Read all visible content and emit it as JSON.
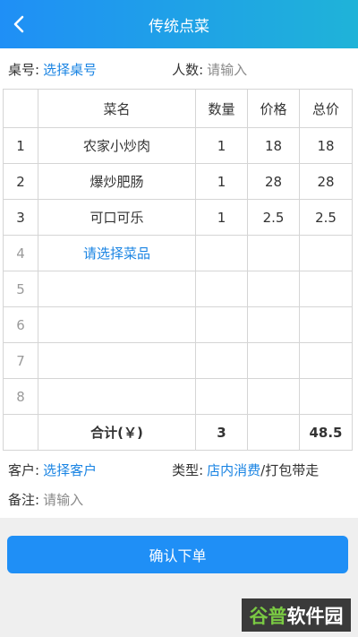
{
  "header": {
    "title": "传统点菜"
  },
  "info": {
    "table_label": "桌号:",
    "table_link": "选择桌号",
    "people_label": "人数:",
    "people_placeholder": "请输入"
  },
  "grid": {
    "headers": [
      "",
      "菜名",
      "数量",
      "价格",
      "总价"
    ],
    "rows": [
      {
        "idx": "1",
        "name": "农家小炒肉",
        "qty": "1",
        "price": "18",
        "total": "18"
      },
      {
        "idx": "2",
        "name": "爆炒肥肠",
        "qty": "1",
        "price": "28",
        "total": "28"
      },
      {
        "idx": "3",
        "name": "可口可乐",
        "qty": "1",
        "price": "2.5",
        "total": "2.5"
      },
      {
        "idx": "4",
        "name": "请选择菜品",
        "qty": "",
        "price": "",
        "total": ""
      },
      {
        "idx": "5",
        "name": "",
        "qty": "",
        "price": "",
        "total": ""
      },
      {
        "idx": "6",
        "name": "",
        "qty": "",
        "price": "",
        "total": ""
      },
      {
        "idx": "7",
        "name": "",
        "qty": "",
        "price": "",
        "total": ""
      },
      {
        "idx": "8",
        "name": "",
        "qty": "",
        "price": "",
        "total": ""
      }
    ],
    "footer": {
      "label": "合计(￥)",
      "qty": "3",
      "total": "48.5"
    }
  },
  "customer": {
    "label": "客户:",
    "link": "选择客户",
    "type_label": "类型:",
    "type_dine_in": "店内消费",
    "type_takeout": "/打包带走"
  },
  "note": {
    "label": "备注:",
    "placeholder": "请输入"
  },
  "actions": {
    "confirm": "确认下单"
  },
  "watermark": {
    "part1": "谷普",
    "part2": "软件园"
  },
  "colors": {
    "accent": "#1f8ff6",
    "link": "#1a84e3"
  },
  "icons": {
    "back": "chevron-left-icon"
  }
}
